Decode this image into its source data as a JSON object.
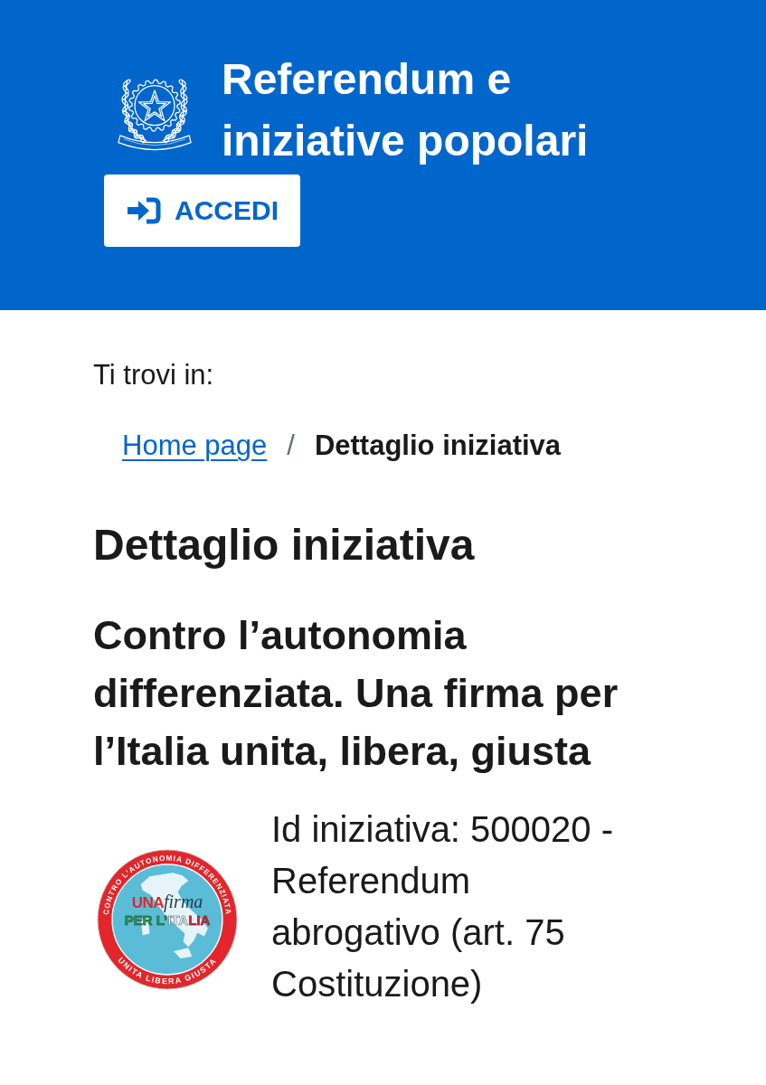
{
  "header": {
    "title": "Referendum e iniziative popolari",
    "login_button": {
      "label": "ACCEDI"
    }
  },
  "breadcrumb": {
    "label": "Ti trovi in:",
    "separator": "/",
    "items": [
      {
        "label": "Home page",
        "kind": "link"
      },
      {
        "label": "Dettaglio iniziativa",
        "kind": "current"
      }
    ]
  },
  "page_title": "Dettaglio iniziativa",
  "initiative": {
    "title": "Contro l’autonomia differenziata. Una firma per l’Italia unita, libera, giusta",
    "logo": {
      "top_text": "CONTRO L’AUTONOMIA DIFFERENZIATA",
      "slogan_word": "UNA",
      "slogan_script": "firma",
      "slogan_line": "PER L’ITALIA",
      "bottom_text": "UNITA LIBERA GIUSTA"
    },
    "description": "Id iniziativa: 500020 - Referendum abrogativo (art. 75 Costituzione)"
  }
}
